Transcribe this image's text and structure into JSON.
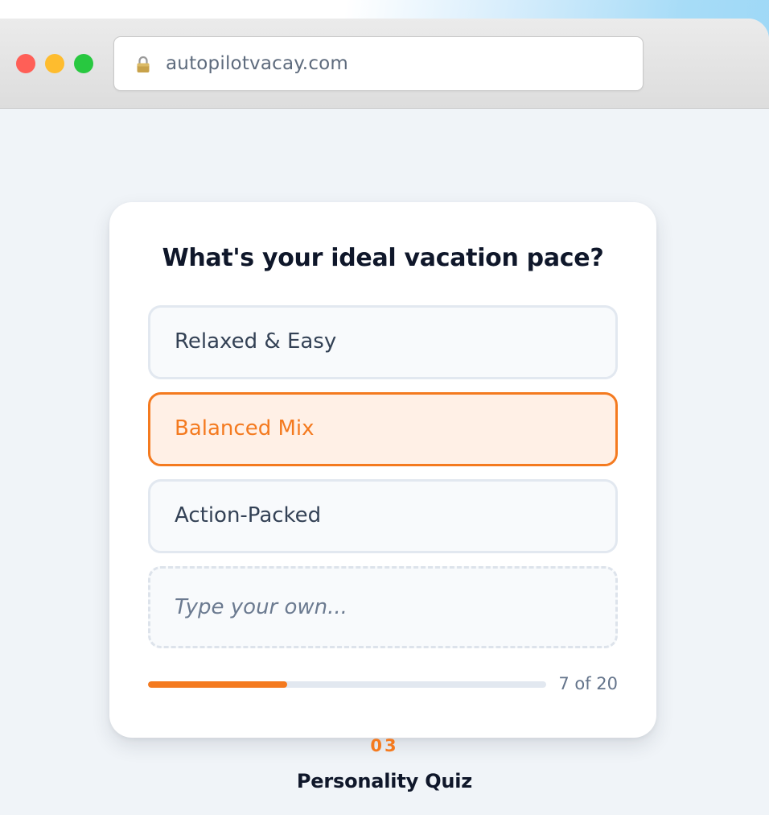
{
  "browser": {
    "url": "autopilotvacay.com",
    "icons": {
      "lock": "lock-icon"
    },
    "traffic_lights": {
      "close": "#ff5f57",
      "minimize": "#febc2e",
      "zoom": "#28c840"
    }
  },
  "quiz": {
    "question": "What's your ideal vacation pace?",
    "options": [
      {
        "label": "Relaxed & Easy",
        "selected": false
      },
      {
        "label": "Balanced Mix",
        "selected": true
      },
      {
        "label": "Action-Packed",
        "selected": false
      }
    ],
    "custom_placeholder": "Type your own...",
    "progress": {
      "current": 7,
      "total": 20,
      "text": "7 of 20",
      "fill_fraction": 0.35
    }
  },
  "footer": {
    "step_number": "03",
    "title": "Personality Quiz"
  },
  "colors": {
    "accent": "#f47a1f",
    "selected_bg": "#fff0e6",
    "heading": "#0f172a",
    "body_text": "#334155"
  }
}
